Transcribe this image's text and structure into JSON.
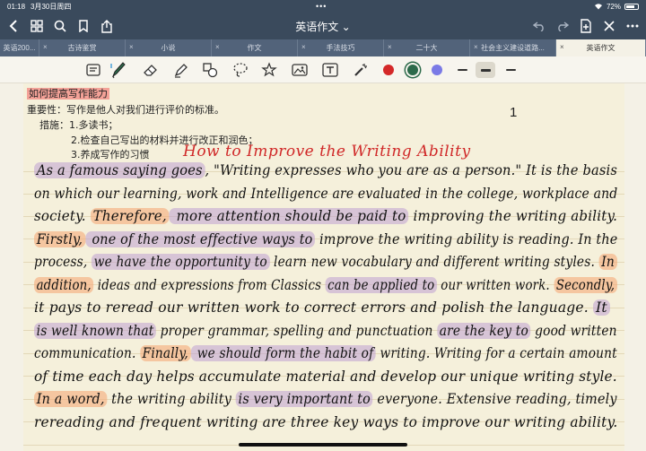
{
  "status_bar": {
    "time": "01:18",
    "date": "3月30日周四",
    "battery": "72%",
    "battery_level": 0.72
  },
  "title_bar": {
    "title": "英语作文",
    "title_chevron": "⌄"
  },
  "tabs": [
    {
      "label": "英语200..."
    },
    {
      "label": "古诗鉴赏"
    },
    {
      "label": "小说"
    },
    {
      "label": "作文"
    },
    {
      "label": "手法技巧"
    },
    {
      "label": "二十大"
    },
    {
      "label": "社会主义建设道路..."
    },
    {
      "label": "英语作文",
      "active": true
    }
  ],
  "toolbar": {
    "colors": [
      "#d42828",
      "#2c6a4a",
      "#7a7ae6"
    ],
    "selected_color_index": 1,
    "line_widths": [
      "thin",
      "thick",
      "medium"
    ],
    "selected_line_index": 1
  },
  "page": {
    "number": "1",
    "typed": {
      "heading": "如何提高写作能力",
      "importance": "重要性：写作是他人对我们进行评价的标准。",
      "measures_label": "措施：",
      "measure_1": "1.多读书；",
      "measure_2": "2.检查自己写出的材料并进行改正和润色；",
      "measure_3": "3.养成写作的习惯"
    },
    "handwritten_title": "How to Improve the Writing Ability",
    "lines": [
      {
        "segments": [
          {
            "text": "As a famous saying goes",
            "hl": "p"
          },
          {
            "text": ", \"Writing expresses who you are as a person.\" It is the basis"
          }
        ]
      },
      {
        "segments": [
          {
            "text": "on which our learning, work and Intelligence are evaluated in the college, workplace and"
          }
        ]
      },
      {
        "segments": [
          {
            "text": "society. "
          },
          {
            "text": "Therefore,",
            "hl": "o"
          },
          {
            "text": " more attention should be paid to",
            "hl": "p"
          },
          {
            "text": " improving the writing ability."
          }
        ]
      },
      {
        "segments": [
          {
            "text": "Firstly,",
            "hl": "o"
          },
          {
            "text": " one of the most effective ways to",
            "hl": "p"
          },
          {
            "text": " improve the writing ability is reading. In the"
          }
        ]
      },
      {
        "segments": [
          {
            "text": "process, "
          },
          {
            "text": "we have the opportunity to",
            "hl": "p"
          },
          {
            "text": " learn new vocabulary and different writing styles. "
          },
          {
            "text": "In",
            "hl": "o"
          }
        ]
      },
      {
        "segments": [
          {
            "text": "addition,",
            "hl": "o"
          },
          {
            "text": " ideas and expressions from Classics "
          },
          {
            "text": "can be applied to",
            "hl": "p"
          },
          {
            "text": " our written work. "
          },
          {
            "text": "Secondly,",
            "hl": "o"
          }
        ]
      },
      {
        "segments": [
          {
            "text": "it pays to reread our written work to correct errors and polish the language. "
          },
          {
            "text": "It",
            "hl": "p"
          }
        ]
      },
      {
        "segments": [
          {
            "text": "is well known that",
            "hl": "p"
          },
          {
            "text": " proper grammar, spelling and punctuation "
          },
          {
            "text": "are the key to",
            "hl": "p"
          },
          {
            "text": " good written"
          }
        ]
      },
      {
        "segments": [
          {
            "text": "communication. "
          },
          {
            "text": "Finally,",
            "hl": "o"
          },
          {
            "text": " we should form the habit of",
            "hl": "p"
          },
          {
            "text": " writing. Writing for a certain amount"
          }
        ]
      },
      {
        "segments": [
          {
            "text": "of time each day helps accumulate material and develop our unique writing style."
          }
        ]
      },
      {
        "segments": [
          {
            "text": "In a word,",
            "hl": "o"
          },
          {
            "text": " the writing ability "
          },
          {
            "text": "is very important to",
            "hl": "p"
          },
          {
            "text": " everyone. Extensive reading, timely"
          }
        ]
      },
      {
        "segments": [
          {
            "text": "rereading and frequent writing are three key ways to improve our writing ability."
          }
        ]
      }
    ]
  }
}
